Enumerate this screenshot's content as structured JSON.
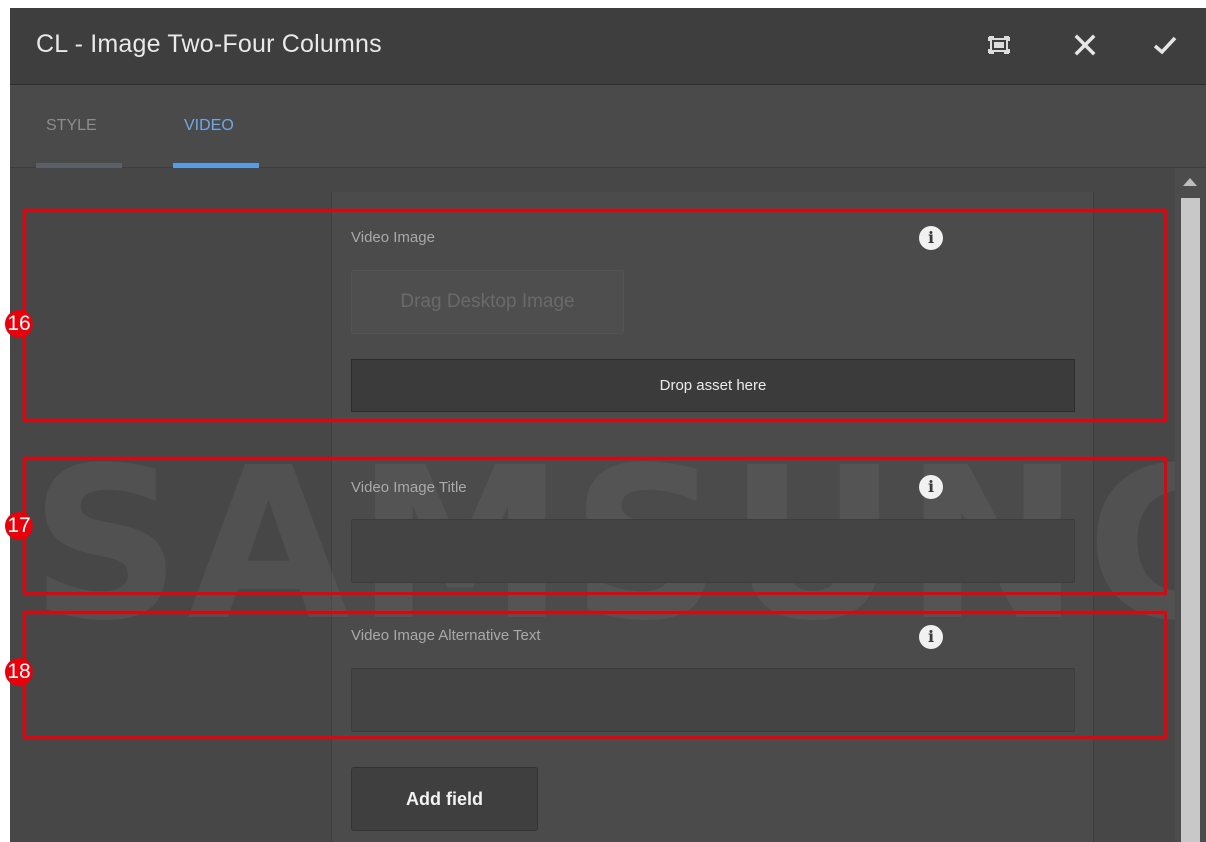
{
  "dialog": {
    "title": "CL - Image Two-Four Columns",
    "buttons": {
      "fullscreen_icon": "fullscreen-icon",
      "close_icon": "close-icon",
      "done_icon": "checkmark-icon"
    }
  },
  "tabs": [
    {
      "label": "STYLE",
      "active": false
    },
    {
      "label": "VIDEO",
      "active": true
    }
  ],
  "fields": {
    "video_image": {
      "label": "Video Image",
      "drag_button": "Drag Desktop Image",
      "drop_zone": "Drop asset here"
    },
    "video_image_title": {
      "label": "Video Image Title",
      "value": ""
    },
    "video_image_alt": {
      "label": "Video Image Alternative Text",
      "value": ""
    }
  },
  "add_field_label": "Add field",
  "watermark": "SAMSUNG",
  "annotations": [
    "16",
    "17",
    "18"
  ],
  "colors": {
    "highlight": "#e8000b",
    "active_tab": "#6fa8e8",
    "background": "#494949"
  }
}
